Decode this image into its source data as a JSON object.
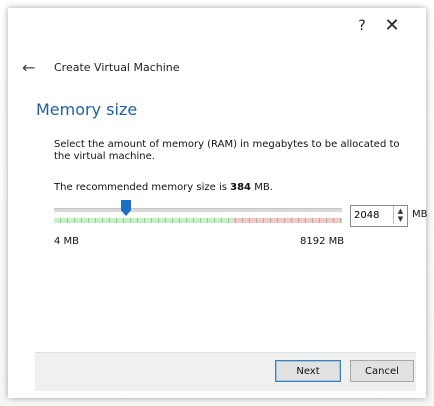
{
  "window": {
    "help_label": "?",
    "close_label": "✕"
  },
  "header": {
    "back_icon": "←",
    "title": "Create Virtual Machine"
  },
  "page": {
    "title": "Memory size",
    "description": "Select the amount of memory (RAM) in megabytes to be allocated to the virtual machine.",
    "recommended_prefix": "The recommended memory size is ",
    "recommended_value": "384",
    "recommended_suffix": " MB."
  },
  "memory": {
    "value": "2048",
    "unit": "MB",
    "min_label": "4 MB",
    "max_label": "8192 MB",
    "slider_level_mb": 2048,
    "slider_min_mb": 4,
    "slider_max_mb": 8192
  },
  "colors": {
    "accent": "#1e6fc8",
    "title": "#1f5fa8",
    "green_zone": "#c6f3c6",
    "red_zone": "#f6c9c9"
  },
  "buttons": {
    "next_label": "Next",
    "cancel_label": "Cancel"
  }
}
